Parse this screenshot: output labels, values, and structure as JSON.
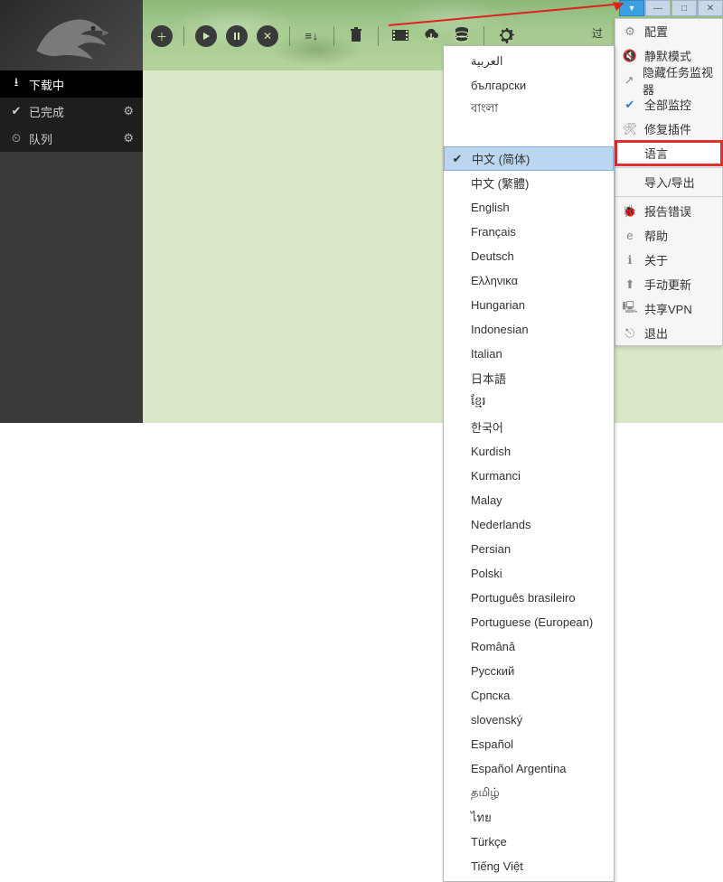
{
  "titlebar": {
    "menu": "▾",
    "minimize": "—",
    "maximize": "□",
    "close": "✕"
  },
  "sidebar": {
    "items": [
      {
        "label": "下载中",
        "icon": "download"
      },
      {
        "label": "已完成",
        "icon": "check"
      },
      {
        "label": "队列",
        "icon": "clock"
      }
    ]
  },
  "filter_partial": "过",
  "settings_menu": {
    "items": [
      {
        "label": "配置",
        "icon": "gear"
      },
      {
        "label": "静默模式",
        "icon": "mute"
      },
      {
        "label": "隐藏任务监视器",
        "icon": "share"
      },
      {
        "label": "全部监控",
        "icon": "check-blue"
      },
      {
        "label": "修复插件",
        "icon": "wrench"
      },
      {
        "label": "语言",
        "icon": "blank",
        "highlight": true
      },
      {
        "sep": true
      },
      {
        "label": "导入/导出",
        "icon": "blank"
      },
      {
        "sep": true
      },
      {
        "label": "报告错误",
        "icon": "bug"
      },
      {
        "label": "帮助",
        "icon": "e"
      },
      {
        "label": "关于",
        "icon": "info"
      },
      {
        "label": "手动更新",
        "icon": "up"
      },
      {
        "label": "共享VPN",
        "icon": "vpn"
      },
      {
        "label": "退出",
        "icon": "exit"
      }
    ]
  },
  "languages": {
    "selected_index": 4,
    "items": [
      "العربية",
      "български",
      "বাংলা",
      "",
      "中文 (简体)",
      "中文 (繁體)",
      "English",
      "Français",
      "Deutsch",
      "Ελληνικα",
      "Hungarian",
      "Indonesian",
      "Italian",
      "日本語",
      "ខ្មែរ",
      "한국어",
      "Kurdish",
      "Kurmanci",
      "Malay",
      "Nederlands",
      "Persian",
      "Polski",
      "Português brasileiro",
      "Portuguese (European)",
      "Română",
      "Русский",
      "Српска",
      "slovenský",
      "Español",
      "Español Argentina",
      "தமிழ்",
      "ไทย",
      "Türkçe",
      "Tiếng Việt"
    ]
  }
}
